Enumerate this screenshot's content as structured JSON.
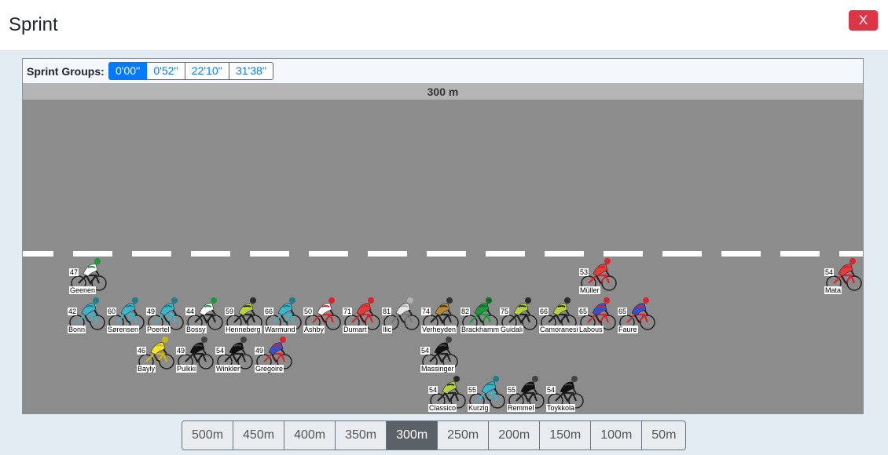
{
  "title": "Sprint",
  "close_label": "X",
  "sprint_groups": {
    "label": "Sprint Groups:",
    "options": [
      "0'00''",
      "0'52''",
      "22'10''",
      "31'38''"
    ],
    "selected": "0'00''"
  },
  "distance_label": "300 m",
  "distance_options": [
    "500m",
    "450m",
    "400m",
    "350m",
    "300m",
    "250m",
    "200m",
    "150m",
    "100m",
    "50m"
  ],
  "distance_selected": "300m",
  "jersey_colors": {
    "white-green": "#ffffff",
    "teal": "#39b6cc",
    "green": "#1a9a3a",
    "lime": "#b5d43c",
    "red": "#d7262e",
    "white-red": "#e63b3b",
    "polka": "#ffffff",
    "silver": "#e6e6e6",
    "gold": "#b58a2a",
    "blue-red": "#3850c8",
    "yellow": "#f2e32c",
    "black": "#111111"
  },
  "riders": [
    {
      "num": "47",
      "name": "Geenen",
      "jersey": "white-green",
      "row": 0,
      "col": 0
    },
    {
      "num": "53",
      "name": "Müller",
      "jersey": "white-red",
      "row": 0,
      "col": 1
    },
    {
      "num": "54",
      "name": "Mata",
      "jersey": "white-red",
      "row": 0,
      "col": 2
    },
    {
      "num": "42",
      "name": "Bonn",
      "jersey": "teal",
      "row": 1,
      "col": 0
    },
    {
      "num": "60",
      "name": "Sørensen",
      "jersey": "teal",
      "row": 1,
      "col": 1
    },
    {
      "num": "49",
      "name": "Poertel",
      "jersey": "teal",
      "row": 1,
      "col": 2
    },
    {
      "num": "44",
      "name": "Bossy",
      "jersey": "white-green",
      "row": 1,
      "col": 3
    },
    {
      "num": "59",
      "name": "Henneberg",
      "jersey": "lime",
      "row": 1,
      "col": 4
    },
    {
      "num": "66",
      "name": "Warmund",
      "jersey": "teal",
      "row": 1,
      "col": 5
    },
    {
      "num": "50",
      "name": "Ashby",
      "jersey": "polka",
      "row": 1,
      "col": 6
    },
    {
      "num": "71",
      "name": "Dumart",
      "jersey": "white-red",
      "row": 1,
      "col": 7
    },
    {
      "num": "81",
      "name": "Ilic",
      "jersey": "silver",
      "row": 1,
      "col": 8
    },
    {
      "num": "74",
      "name": "Verheyden",
      "jersey": "gold",
      "row": 1,
      "col": 9
    },
    {
      "num": "82",
      "name": "Brackhamm",
      "jersey": "green",
      "row": 1,
      "col": 10
    },
    {
      "num": "75",
      "name": "Guidali",
      "jersey": "lime",
      "row": 1,
      "col": 11
    },
    {
      "num": "66",
      "name": "Camoranesi",
      "jersey": "lime",
      "row": 1,
      "col": 12
    },
    {
      "num": "65",
      "name": "Labous",
      "jersey": "blue-red",
      "row": 1,
      "col": 13
    },
    {
      "num": "65",
      "name": "Faure",
      "jersey": "blue-red",
      "row": 1,
      "col": 14
    },
    {
      "num": "46",
      "name": "Bayly",
      "jersey": "yellow",
      "row": 2,
      "col": 0
    },
    {
      "num": "49",
      "name": "Pulkki",
      "jersey": "black",
      "row": 2,
      "col": 1
    },
    {
      "num": "54",
      "name": "Winkler",
      "jersey": "black",
      "row": 2,
      "col": 2
    },
    {
      "num": "49",
      "name": "Gregoire",
      "jersey": "blue-red",
      "row": 2,
      "col": 3
    },
    {
      "num": "54",
      "name": "Massinger",
      "jersey": "black",
      "row": 2,
      "col": 4
    },
    {
      "num": "54",
      "name": "Classico",
      "jersey": "lime",
      "row": 3,
      "col": 0
    },
    {
      "num": "55",
      "name": "Kurzig",
      "jersey": "teal",
      "row": 3,
      "col": 1
    },
    {
      "num": "55",
      "name": "Remmel",
      "jersey": "black",
      "row": 3,
      "col": 2
    },
    {
      "num": "54",
      "name": "Toykkola",
      "jersey": "black",
      "row": 3,
      "col": 3
    }
  ]
}
